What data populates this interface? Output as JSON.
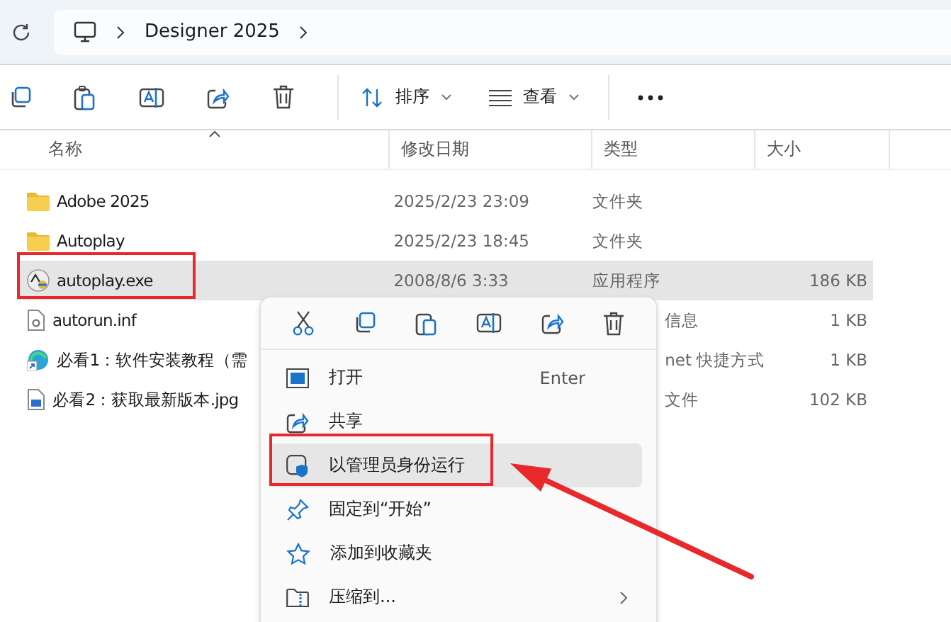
{
  "address_bar": {
    "crumbs": [
      "Designer 2025"
    ]
  },
  "toolbar": {
    "sort_label": "排序",
    "view_label": "查看"
  },
  "table": {
    "columns": [
      "名称",
      "修改日期",
      "类型",
      "大小"
    ],
    "rows": [
      {
        "kind": "folder",
        "name": "Adobe 2025",
        "modified": "2025/2/23 23:09",
        "type": "文件夹",
        "selected": false
      },
      {
        "kind": "folder",
        "name": "Autoplay",
        "modified": "2025/2/23 18:45",
        "type": "文件夹",
        "selected": false
      },
      {
        "kind": "exe",
        "name": "autoplay.exe",
        "modified": "2008/8/6 3:33",
        "type": "应用程序",
        "size": "186 KB",
        "selected": true
      },
      {
        "kind": "inf",
        "name": "autorun.inf",
        "type": "信息",
        "size": "1 KB",
        "selected": false
      },
      {
        "kind": "shortcut",
        "name": "必看1：软件安装教程（需",
        "type": "net 快捷方式",
        "size": "1 KB",
        "selected": false
      },
      {
        "kind": "image",
        "name": "必看2：获取最新版本.jpg",
        "type": "文件",
        "size": "102 KB",
        "selected": false
      }
    ]
  },
  "context_menu": {
    "items": [
      {
        "kind": "open",
        "label": "打开",
        "shortcut": "Enter",
        "selected": false
      },
      {
        "kind": "share",
        "label": "共享",
        "selected": false
      },
      {
        "kind": "admin",
        "label": "以管理员身份运行",
        "selected": true
      },
      {
        "kind": "pin",
        "label": "固定到“开始”",
        "selected": false
      },
      {
        "kind": "favorite",
        "label": "添加到收藏夹",
        "selected": false
      },
      {
        "kind": "compress",
        "label": "压缩到...",
        "submenu": true,
        "selected": false
      }
    ]
  }
}
